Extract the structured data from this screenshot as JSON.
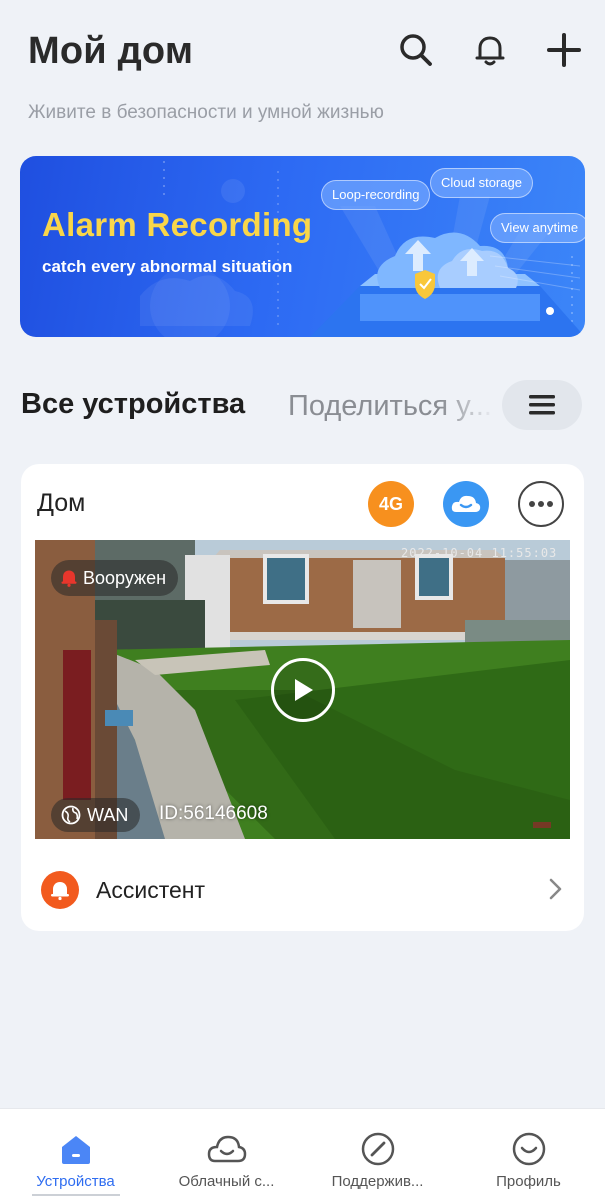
{
  "header": {
    "title": "Мой дом",
    "subtitle": "Живите в безопасности и умной жизнью",
    "icons": [
      "search-icon",
      "bell-icon",
      "plus-icon"
    ]
  },
  "banner": {
    "title": "Alarm Recording",
    "subtitle": "catch every abnormal situation",
    "pills": [
      "Loop-recording",
      "Cloud storage",
      "View anytime"
    ],
    "colors": {
      "title": "#f9d64a",
      "background": "#2d6af3"
    }
  },
  "devices_section": {
    "title": "Все устройства",
    "share_label": "Поделиться у...",
    "menu_icon": "hamburger-menu-icon"
  },
  "device_card": {
    "name": "Дом",
    "badge_4g": "4G",
    "cloud_icon": "cloud-icon",
    "more_icon": "more-horizontal-icon",
    "armed_label": "Вооружен",
    "network_label": "WAN",
    "device_id": "ID:56146608",
    "timestamp": "2022-10-04 11:55:03",
    "assistant_label": "Ассистент",
    "colors": {
      "badge_4g": "#f7901e",
      "cloud": "#3a97f3",
      "assistant": "#f25a1e",
      "armed": "#e8362c"
    }
  },
  "bottom_nav": {
    "items": [
      {
        "label": "Устройства",
        "icon": "home-icon",
        "active": true
      },
      {
        "label": "Облачный с...",
        "icon": "cloud-outline-icon",
        "active": false
      },
      {
        "label": "Поддержив...",
        "icon": "support-icon",
        "active": false
      },
      {
        "label": "Профиль",
        "icon": "profile-icon",
        "active": false
      }
    ],
    "colors": {
      "active": "#2f6df0",
      "inactive": "#555555"
    }
  }
}
